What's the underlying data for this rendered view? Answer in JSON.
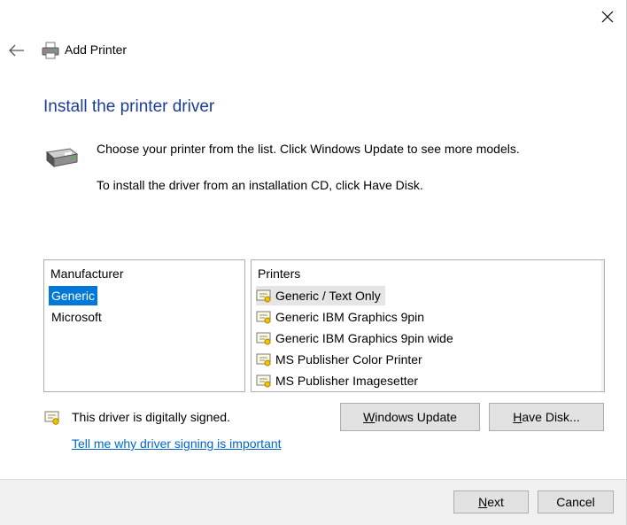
{
  "window": {
    "title": "Add Printer"
  },
  "page": {
    "heading": "Install the printer driver",
    "description_line1": "Choose your printer from the list. Click Windows Update to see more models.",
    "description_line2": "To install the driver from an installation CD, click Have Disk."
  },
  "manufacturer_list": {
    "header": "Manufacturer",
    "items": [
      {
        "label": "Generic",
        "selected": true
      },
      {
        "label": "Microsoft",
        "selected": false
      }
    ]
  },
  "printers_list": {
    "header": "Printers",
    "items": [
      {
        "label": "Generic / Text Only",
        "selected": true
      },
      {
        "label": "Generic IBM Graphics 9pin",
        "selected": false
      },
      {
        "label": "Generic IBM Graphics 9pin wide",
        "selected": false
      },
      {
        "label": "MS Publisher Color Printer",
        "selected": false
      },
      {
        "label": "MS Publisher Imagesetter",
        "selected": false
      }
    ]
  },
  "signing": {
    "status_text": "This driver is digitally signed.",
    "link_text": "Tell me why driver signing is important"
  },
  "buttons": {
    "windows_update": {
      "access_key": "W",
      "rest": "indows Update"
    },
    "have_disk": {
      "access_key": "H",
      "rest": "ave Disk..."
    },
    "next": {
      "access_key": "N",
      "rest": "ext"
    },
    "cancel": "Cancel"
  },
  "colors": {
    "heading": "#1a3e96",
    "selection": "#0078d7",
    "link": "#0066cc"
  }
}
